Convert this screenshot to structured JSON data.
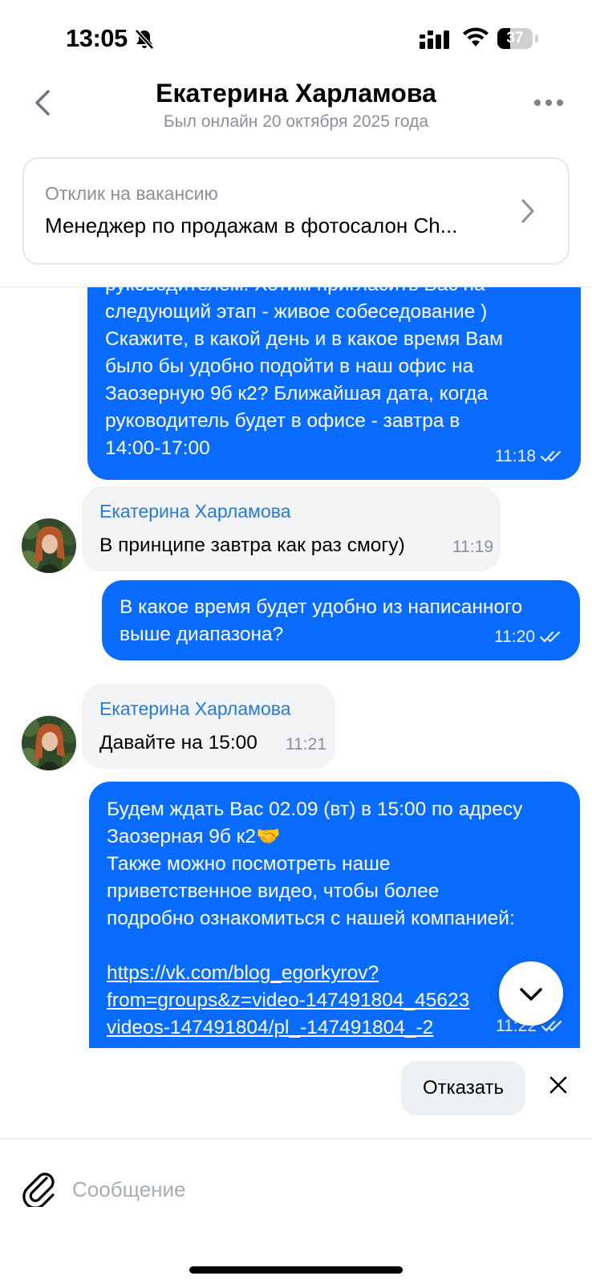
{
  "status_bar": {
    "time": "13:05",
    "battery": "37",
    "battery_level": 0.37
  },
  "header": {
    "title": "Екатерина Харламова",
    "subtitle": "Был онлайн 20 октября 2025 года"
  },
  "vacancy": {
    "label": "Отклик на вакансию",
    "title": "Менеджер по продажам в фотосалон Ch..."
  },
  "messages": [
    {
      "direction": "out",
      "text": "руководителем. Хотим пригласить Вас на\nследующий этап - живое собеседование )\nСкажите, в какой день и в какое время Вам\nбыло бы удобно подойти в наш офис на\nЗаозерную 9б к2? Ближайшая дата, когда\nруководитель будет в офисе - завтра в\n14:00-17:00",
      "time": "11:18"
    },
    {
      "direction": "in",
      "sender": "Екатерина Харламова",
      "text": "В принципе завтра как раз смогу)",
      "time": "11:19"
    },
    {
      "direction": "out",
      "text": "В какое время будет удобно из написанного\nвыше диапазона?",
      "time": "11:20"
    },
    {
      "direction": "in",
      "sender": "Екатерина Харламова",
      "text": "Давайте на 15:00",
      "time": "11:21"
    },
    {
      "direction": "out",
      "text": "Будем ждать Вас 02.09 (вт) в 15:00 по адресу\nЗаозерная 9б к2🤝\nТакже можно посмотреть наше\nприветственное видео, чтобы более\nподробно ознакомиться с нашей компанией:",
      "link": "https://vk.com/blog_egorkyrov?\nfrom=groups&z=video-147491804_45623\nvideos-147491804/pl_-147491804_-2",
      "time": "11:22"
    }
  ],
  "quick_actions": {
    "refuse_label": "Отказать"
  },
  "composer": {
    "placeholder": "Сообщение"
  },
  "colors": {
    "accent": "#0a6cff",
    "sender_name": "#2979d8",
    "incoming_bg": "#f2f3f5"
  },
  "icons": [
    "bell-muted-icon",
    "signal-icon",
    "wifi-icon",
    "battery-icon",
    "back-arrow-icon",
    "more-icon",
    "chevron-right-icon",
    "double-check-icon",
    "chevron-down-icon",
    "close-icon",
    "paperclip-icon"
  ]
}
